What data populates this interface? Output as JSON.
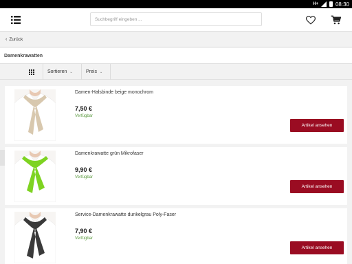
{
  "status_bar": {
    "network": "H+",
    "time": "08:30"
  },
  "header": {
    "search_placeholder": "Suchbegriff eingeben ..."
  },
  "back": {
    "label": "Zurück"
  },
  "page": {
    "title": "Damenkrawatten"
  },
  "toolbar": {
    "sort_label": "Sortieren",
    "price_label": "Preis"
  },
  "products": [
    {
      "name": "Damen-Halsbinde beige monochrom",
      "price": "7,50 €",
      "availability": "Verfügbar",
      "cta": "Artikel ansehen",
      "scarf_color": "#d8c8ae"
    },
    {
      "name": "Damenkrawatte grün Mikrofaser",
      "price": "9,90 €",
      "availability": "Verfügbar",
      "cta": "Artikel ansehen",
      "scarf_color": "#7ed321"
    },
    {
      "name": "Service-Damenkrawatte dunkelgrau Poly-Faser",
      "price": "7,90 €",
      "availability": "Verfügbar",
      "cta": "Artikel ansehen",
      "scarf_color": "#3a3a3a"
    }
  ],
  "colors": {
    "accent": "#9a0c22",
    "available": "#5a9a3e"
  }
}
